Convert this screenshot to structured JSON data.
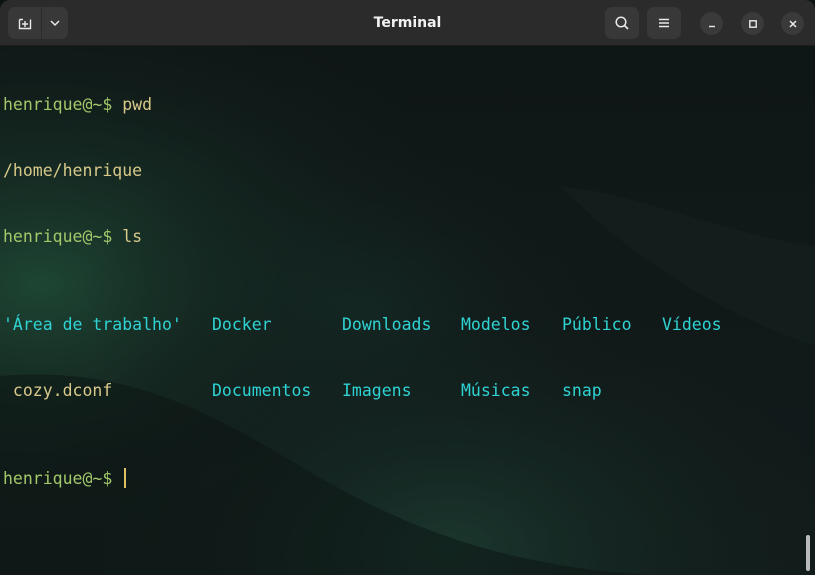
{
  "window": {
    "title": "Terminal"
  },
  "icons": {
    "new_tab": "new-tab-icon",
    "dropdown": "chevron-down-icon",
    "search": "search-icon",
    "menu": "hamburger-menu-icon",
    "minimize": "minimize-icon",
    "maximize": "maximize-icon",
    "close": "close-icon"
  },
  "colors": {
    "prompt": "#a3c86a",
    "text": "#d8c98a",
    "directory": "#2fd3d3",
    "headerbar": "#2b2b2b"
  },
  "terminal": {
    "lines": [
      {
        "prompt": "henrique@~$",
        "command": " pwd"
      },
      {
        "output": "/home/henrique"
      },
      {
        "prompt": "henrique@~$",
        "command": " ls"
      }
    ],
    "ls_row1": [
      "'Área de trabalho'",
      "Docker",
      "Downloads",
      "Modelos",
      "Público",
      "Vídeos"
    ],
    "ls_row2": [
      " cozy.dconf",
      "Documentos",
      "Imagens",
      "Músicas",
      "snap"
    ],
    "final_prompt": "henrique@~$"
  }
}
